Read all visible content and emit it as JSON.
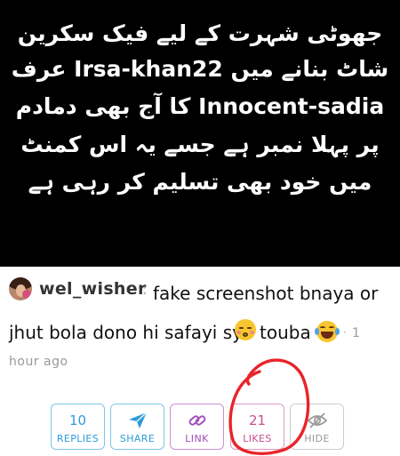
{
  "post_image": {
    "lines": [
      "جھوٹی شہرت کے لیے فیک سکرین",
      "شاٹ بنانے میں Irsa-khan22 عرف",
      "Innocent-sadia کا آج بھی دمادم",
      "پر پہلا نمبر ہے جسے یہ اس کمنٹ",
      "میں خود بھی تسلیم کر رہی ہے"
    ]
  },
  "comment": {
    "username": "wel_wisher",
    "separator": ":",
    "text_line1": "fake screenshot bnaya or",
    "text_line2": "jhut bola dono hi safayi sy",
    "text_line3": "touba",
    "emojis": [
      "flushed-kiss-emoji",
      "tears-of-joy-emoji"
    ],
    "time_dot": "·",
    "time_part1": "1",
    "time_part2": "hour ago"
  },
  "actions": {
    "replies": {
      "count": "10",
      "label": "REPLIES",
      "color": "#2e9bd6"
    },
    "share": {
      "icon": "send-icon",
      "label": "SHARE",
      "color": "#2e9bd6"
    },
    "link": {
      "icon": "link-icon",
      "label": "LINK",
      "color": "#a24fbd"
    },
    "likes": {
      "count": "21",
      "label": "LIKES",
      "color": "#c74f8e"
    },
    "hide": {
      "icon": "eye-off-icon",
      "label": "HIDE",
      "color": "#9a9a9a"
    }
  },
  "annotation": {
    "shape": "hand-drawn-circle",
    "color": "#e8242a",
    "target": "likes"
  }
}
